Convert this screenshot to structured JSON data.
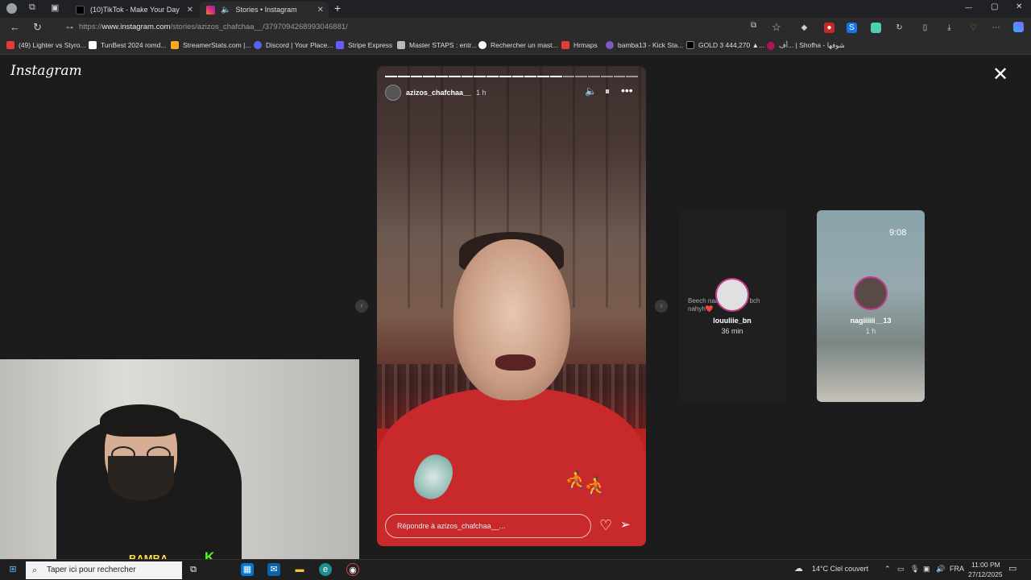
{
  "browser": {
    "tabs": [
      {
        "label": "(10)TikTok - Make Your Day",
        "active": false
      },
      {
        "label": "Stories • Instagram",
        "active": true
      }
    ],
    "new_tab": "+",
    "window_controls": {
      "minimize": "—",
      "maximize": "▢",
      "close": "✕"
    },
    "url": {
      "prefix": "https://",
      "host": "www.instagram.com",
      "path": "/stories/azizos_chafchaa__/3797094268993046881/"
    },
    "bookmarks": [
      "(49) Lighter vs Styro...",
      "TunBest 2024 romd...",
      "StreamerStats.com |...",
      "Discord | Your Place...",
      "Stripe Express",
      "Master STAPS : entr...",
      "Rechercher un mast...",
      "Hrmaps",
      "bamba13 - Kick Sta...",
      "GOLD 3 444,270 ▲...",
      "أف... | Shofha - شوفها"
    ]
  },
  "instagram": {
    "logo": "Instagram",
    "story": {
      "username": "azizos_chafchaa__",
      "time": "1 h",
      "reply_placeholder": "Répondre à azizos_chafchaa__...",
      "progress_total": 20,
      "progress_done": 14
    },
    "previews": [
      {
        "username": "louuliie_bn",
        "time": "36 min",
        "text": "Beech naar ... hedha bch nahyh❤️"
      },
      {
        "username": "nagiiiiii__13",
        "time": "1 h",
        "clock": "9:08"
      }
    ]
  },
  "webcam": {
    "logo": "BAMBA",
    "badge": "K"
  },
  "taskbar": {
    "search_placeholder": "Taper ici pour rechercher",
    "weather": "14°C  Ciel couvert",
    "language": "FRA",
    "time": "11:00 PM",
    "date": "27/12/2025"
  }
}
